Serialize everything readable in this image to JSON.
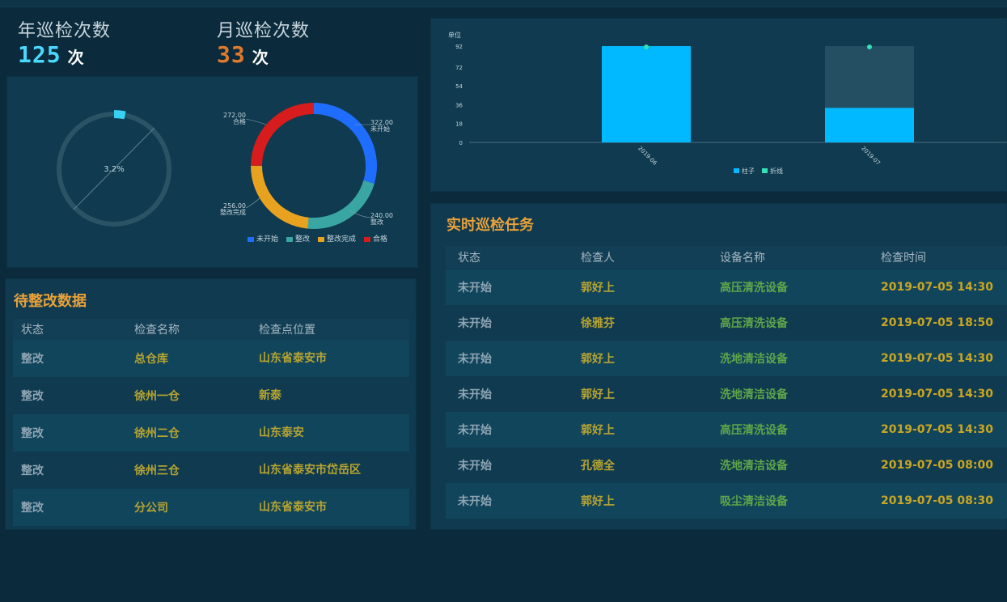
{
  "kpi": {
    "yearly": {
      "label": "年巡检次数",
      "value": "125",
      "unit": "次"
    },
    "monthly": {
      "label": "月巡检次数",
      "value": "33",
      "unit": "次"
    }
  },
  "colors": {
    "bg": "#0b2a3b",
    "panel": "#0f3a4f",
    "accent_cyan": "#21c6ff",
    "kpi_cyan": "#49d9ff",
    "kpi_orange": "#e07a2b",
    "title_orange": "#e8a23a",
    "table_olive": "#b7a431",
    "table_green": "#5fa64a",
    "table_gold": "#c9a623"
  },
  "gauge": {
    "percent_label": "3.2%",
    "value": 3.2,
    "max": 100
  },
  "donut": {
    "type": "pie",
    "slices": [
      {
        "label": "未开始",
        "value_label": "322.00",
        "value": 322.0,
        "color": "#1f6dff"
      },
      {
        "label": "整改",
        "value_label": "240.00",
        "value": 240.0,
        "color": "#3aa6a3"
      },
      {
        "label": "整改完成",
        "value_label": "256.00",
        "value": 256.0,
        "color": "#e7a320"
      },
      {
        "label": "合格",
        "value_label": "272.00",
        "value": 272.0,
        "color": "#d61c1c"
      }
    ],
    "legend": [
      "未开始",
      "整改",
      "整改完成",
      "合格"
    ]
  },
  "chart_data": {
    "type": "bar",
    "categories": [
      "2019-06",
      "2019-07"
    ],
    "series": [
      {
        "name": "柱子",
        "type": "bar",
        "values": [
          92,
          33
        ]
      },
      {
        "name": "折线",
        "type": "line",
        "values": [
          92,
          92
        ]
      }
    ],
    "ylabel": "单位",
    "yticks": [
      0,
      18,
      36,
      54,
      72,
      92
    ],
    "ylim": [
      0,
      92
    ],
    "legend": [
      "柱子",
      "折线"
    ],
    "colors": {
      "bar": "#00b9ff",
      "bar_bg": "#244f63",
      "line_point": "#35e0b6"
    }
  },
  "pending": {
    "title": "待整改数据",
    "headers": [
      "状态",
      "检查名称",
      "检查点位置"
    ],
    "rows": [
      {
        "status": "整改",
        "name": "总仓库",
        "location": "山东省泰安市"
      },
      {
        "status": "整改",
        "name": "徐州一仓",
        "location": "新泰"
      },
      {
        "status": "整改",
        "name": "徐州二仓",
        "location": "山东泰安"
      },
      {
        "status": "整改",
        "name": "徐州三仓",
        "location": "山东省泰安市岱岳区"
      },
      {
        "status": "整改",
        "name": "分公司",
        "location": "山东省泰安市"
      }
    ]
  },
  "tasks": {
    "title": "实时巡检任务",
    "headers": [
      "状态",
      "检查人",
      "设备名称",
      "检查时间"
    ],
    "rows": [
      {
        "status": "未开始",
        "person": "郭好上",
        "device": "高压清洗设备",
        "time": "2019-07-05 14:30"
      },
      {
        "status": "未开始",
        "person": "徐雅芬",
        "device": "高压清洗设备",
        "time": "2019-07-05 18:50"
      },
      {
        "status": "未开始",
        "person": "郭好上",
        "device": "洗地清洁设备",
        "time": "2019-07-05 14:30"
      },
      {
        "status": "未开始",
        "person": "郭好上",
        "device": "洗地清洁设备",
        "time": "2019-07-05 14:30"
      },
      {
        "status": "未开始",
        "person": "郭好上",
        "device": "高压清洗设备",
        "time": "2019-07-05 14:30"
      },
      {
        "status": "未开始",
        "person": "孔德全",
        "device": "洗地清洁设备",
        "time": "2019-07-05 08:00"
      },
      {
        "status": "未开始",
        "person": "郭好上",
        "device": "吸尘清洁设备",
        "time": "2019-07-05 08:30"
      }
    ]
  }
}
